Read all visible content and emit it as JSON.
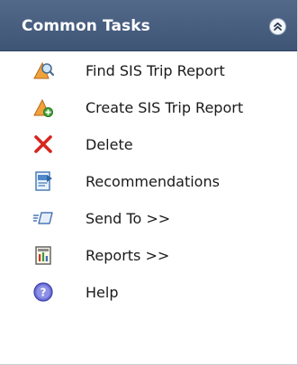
{
  "panel": {
    "title": "Common Tasks",
    "collapse_icon": "double-chevron-up-icon",
    "header_color": "#475d7e"
  },
  "tasks": [
    {
      "label": "Find SIS Trip Report",
      "icon": "find-report-icon"
    },
    {
      "label": "Create SIS Trip Report",
      "icon": "create-report-icon"
    },
    {
      "label": "Delete",
      "icon": "delete-x-icon"
    },
    {
      "label": "Recommendations",
      "icon": "recommendations-icon"
    },
    {
      "label": "Send To >>",
      "icon": "send-to-icon"
    },
    {
      "label": "Reports >>",
      "icon": "reports-icon"
    },
    {
      "label": "Help",
      "icon": "help-icon"
    }
  ]
}
